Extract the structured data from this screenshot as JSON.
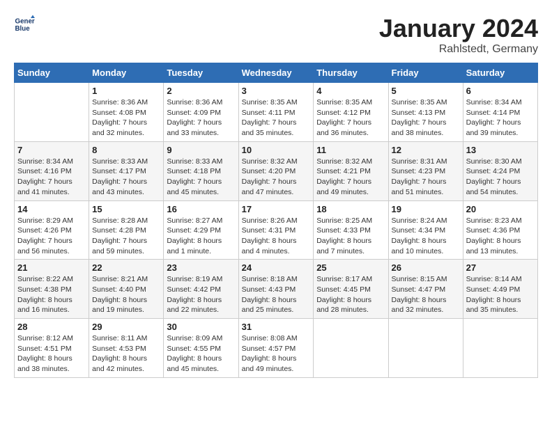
{
  "header": {
    "logo_line1": "General",
    "logo_line2": "Blue",
    "month": "January 2024",
    "location": "Rahlstedt, Germany"
  },
  "weekdays": [
    "Sunday",
    "Monday",
    "Tuesday",
    "Wednesday",
    "Thursday",
    "Friday",
    "Saturday"
  ],
  "weeks": [
    [
      {
        "day": "",
        "sunrise": "",
        "sunset": "",
        "daylight": ""
      },
      {
        "day": "1",
        "sunrise": "Sunrise: 8:36 AM",
        "sunset": "Sunset: 4:08 PM",
        "daylight": "Daylight: 7 hours and 32 minutes."
      },
      {
        "day": "2",
        "sunrise": "Sunrise: 8:36 AM",
        "sunset": "Sunset: 4:09 PM",
        "daylight": "Daylight: 7 hours and 33 minutes."
      },
      {
        "day": "3",
        "sunrise": "Sunrise: 8:35 AM",
        "sunset": "Sunset: 4:11 PM",
        "daylight": "Daylight: 7 hours and 35 minutes."
      },
      {
        "day": "4",
        "sunrise": "Sunrise: 8:35 AM",
        "sunset": "Sunset: 4:12 PM",
        "daylight": "Daylight: 7 hours and 36 minutes."
      },
      {
        "day": "5",
        "sunrise": "Sunrise: 8:35 AM",
        "sunset": "Sunset: 4:13 PM",
        "daylight": "Daylight: 7 hours and 38 minutes."
      },
      {
        "day": "6",
        "sunrise": "Sunrise: 8:34 AM",
        "sunset": "Sunset: 4:14 PM",
        "daylight": "Daylight: 7 hours and 39 minutes."
      }
    ],
    [
      {
        "day": "7",
        "sunrise": "Sunrise: 8:34 AM",
        "sunset": "Sunset: 4:16 PM",
        "daylight": "Daylight: 7 hours and 41 minutes."
      },
      {
        "day": "8",
        "sunrise": "Sunrise: 8:33 AM",
        "sunset": "Sunset: 4:17 PM",
        "daylight": "Daylight: 7 hours and 43 minutes."
      },
      {
        "day": "9",
        "sunrise": "Sunrise: 8:33 AM",
        "sunset": "Sunset: 4:18 PM",
        "daylight": "Daylight: 7 hours and 45 minutes."
      },
      {
        "day": "10",
        "sunrise": "Sunrise: 8:32 AM",
        "sunset": "Sunset: 4:20 PM",
        "daylight": "Daylight: 7 hours and 47 minutes."
      },
      {
        "day": "11",
        "sunrise": "Sunrise: 8:32 AM",
        "sunset": "Sunset: 4:21 PM",
        "daylight": "Daylight: 7 hours and 49 minutes."
      },
      {
        "day": "12",
        "sunrise": "Sunrise: 8:31 AM",
        "sunset": "Sunset: 4:23 PM",
        "daylight": "Daylight: 7 hours and 51 minutes."
      },
      {
        "day": "13",
        "sunrise": "Sunrise: 8:30 AM",
        "sunset": "Sunset: 4:24 PM",
        "daylight": "Daylight: 7 hours and 54 minutes."
      }
    ],
    [
      {
        "day": "14",
        "sunrise": "Sunrise: 8:29 AM",
        "sunset": "Sunset: 4:26 PM",
        "daylight": "Daylight: 7 hours and 56 minutes."
      },
      {
        "day": "15",
        "sunrise": "Sunrise: 8:28 AM",
        "sunset": "Sunset: 4:28 PM",
        "daylight": "Daylight: 7 hours and 59 minutes."
      },
      {
        "day": "16",
        "sunrise": "Sunrise: 8:27 AM",
        "sunset": "Sunset: 4:29 PM",
        "daylight": "Daylight: 8 hours and 1 minute."
      },
      {
        "day": "17",
        "sunrise": "Sunrise: 8:26 AM",
        "sunset": "Sunset: 4:31 PM",
        "daylight": "Daylight: 8 hours and 4 minutes."
      },
      {
        "day": "18",
        "sunrise": "Sunrise: 8:25 AM",
        "sunset": "Sunset: 4:33 PM",
        "daylight": "Daylight: 8 hours and 7 minutes."
      },
      {
        "day": "19",
        "sunrise": "Sunrise: 8:24 AM",
        "sunset": "Sunset: 4:34 PM",
        "daylight": "Daylight: 8 hours and 10 minutes."
      },
      {
        "day": "20",
        "sunrise": "Sunrise: 8:23 AM",
        "sunset": "Sunset: 4:36 PM",
        "daylight": "Daylight: 8 hours and 13 minutes."
      }
    ],
    [
      {
        "day": "21",
        "sunrise": "Sunrise: 8:22 AM",
        "sunset": "Sunset: 4:38 PM",
        "daylight": "Daylight: 8 hours and 16 minutes."
      },
      {
        "day": "22",
        "sunrise": "Sunrise: 8:21 AM",
        "sunset": "Sunset: 4:40 PM",
        "daylight": "Daylight: 8 hours and 19 minutes."
      },
      {
        "day": "23",
        "sunrise": "Sunrise: 8:19 AM",
        "sunset": "Sunset: 4:42 PM",
        "daylight": "Daylight: 8 hours and 22 minutes."
      },
      {
        "day": "24",
        "sunrise": "Sunrise: 8:18 AM",
        "sunset": "Sunset: 4:43 PM",
        "daylight": "Daylight: 8 hours and 25 minutes."
      },
      {
        "day": "25",
        "sunrise": "Sunrise: 8:17 AM",
        "sunset": "Sunset: 4:45 PM",
        "daylight": "Daylight: 8 hours and 28 minutes."
      },
      {
        "day": "26",
        "sunrise": "Sunrise: 8:15 AM",
        "sunset": "Sunset: 4:47 PM",
        "daylight": "Daylight: 8 hours and 32 minutes."
      },
      {
        "day": "27",
        "sunrise": "Sunrise: 8:14 AM",
        "sunset": "Sunset: 4:49 PM",
        "daylight": "Daylight: 8 hours and 35 minutes."
      }
    ],
    [
      {
        "day": "28",
        "sunrise": "Sunrise: 8:12 AM",
        "sunset": "Sunset: 4:51 PM",
        "daylight": "Daylight: 8 hours and 38 minutes."
      },
      {
        "day": "29",
        "sunrise": "Sunrise: 8:11 AM",
        "sunset": "Sunset: 4:53 PM",
        "daylight": "Daylight: 8 hours and 42 minutes."
      },
      {
        "day": "30",
        "sunrise": "Sunrise: 8:09 AM",
        "sunset": "Sunset: 4:55 PM",
        "daylight": "Daylight: 8 hours and 45 minutes."
      },
      {
        "day": "31",
        "sunrise": "Sunrise: 8:08 AM",
        "sunset": "Sunset: 4:57 PM",
        "daylight": "Daylight: 8 hours and 49 minutes."
      },
      {
        "day": "",
        "sunrise": "",
        "sunset": "",
        "daylight": ""
      },
      {
        "day": "",
        "sunrise": "",
        "sunset": "",
        "daylight": ""
      },
      {
        "day": "",
        "sunrise": "",
        "sunset": "",
        "daylight": ""
      }
    ]
  ]
}
